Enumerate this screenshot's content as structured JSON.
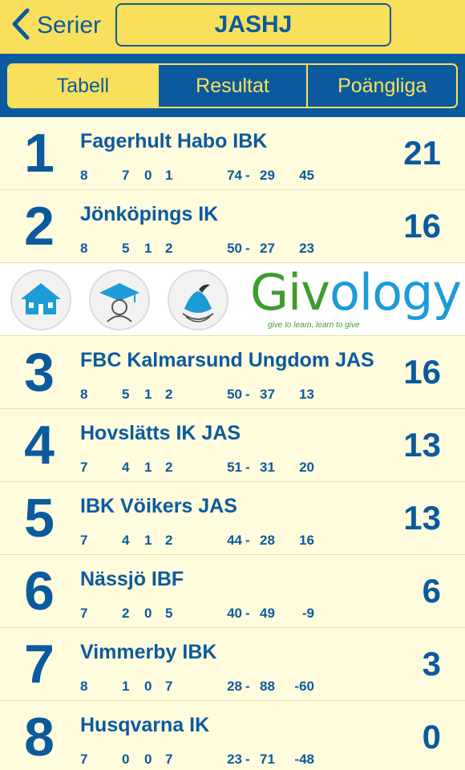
{
  "header": {
    "back_label": "Serier",
    "title": "JASHJ"
  },
  "tabs": [
    {
      "label": "Tabell",
      "active": true
    },
    {
      "label": "Resultat",
      "active": false
    },
    {
      "label": "Poängliga",
      "active": false
    }
  ],
  "standings": [
    {
      "rank": "1",
      "team": "Fagerhult Habo IBK",
      "gp": "8",
      "w": "7",
      "d": "0",
      "l": "1",
      "gf": "74",
      "ga": "29",
      "diff": "45",
      "pts": "21"
    },
    {
      "rank": "2",
      "team": "Jönköpings IK",
      "gp": "8",
      "w": "5",
      "d": "1",
      "l": "2",
      "gf": "50",
      "ga": "27",
      "diff": "23",
      "pts": "16"
    },
    {
      "rank": "3",
      "team": "FBC Kalmarsund Ungdom JAS",
      "gp": "8",
      "w": "5",
      "d": "1",
      "l": "2",
      "gf": "50",
      "ga": "37",
      "diff": "13",
      "pts": "16"
    },
    {
      "rank": "4",
      "team": "Hovslätts IK JAS",
      "gp": "7",
      "w": "4",
      "d": "1",
      "l": "2",
      "gf": "51",
      "ga": "31",
      "diff": "20",
      "pts": "13"
    },
    {
      "rank": "5",
      "team": "IBK Vöikers JAS",
      "gp": "7",
      "w": "4",
      "d": "1",
      "l": "2",
      "gf": "44",
      "ga": "28",
      "diff": "16",
      "pts": "13"
    },
    {
      "rank": "6",
      "team": "Nässjö IBF",
      "gp": "7",
      "w": "2",
      "d": "0",
      "l": "5",
      "gf": "40",
      "ga": "49",
      "diff": "-9",
      "pts": "6"
    },
    {
      "rank": "7",
      "team": "Vimmerby IBK",
      "gp": "8",
      "w": "1",
      "d": "0",
      "l": "7",
      "gf": "28",
      "ga": "88",
      "diff": "-60",
      "pts": "3"
    },
    {
      "rank": "8",
      "team": "Husqvarna IK",
      "gp": "7",
      "w": "0",
      "d": "0",
      "l": "7",
      "gf": "23",
      "ga": "71",
      "diff": "-48",
      "pts": "0"
    }
  ],
  "ad": {
    "brand": "Givology",
    "tagline": "give to learn, learn to give"
  },
  "colors": {
    "primary_blue": "#0b5a9e",
    "accent_yellow": "#f9e05c",
    "row_background": "#fffbdd"
  },
  "icons": {
    "back": "chevron-left-icon",
    "ad_icons": [
      "school-house-icon",
      "graduate-icon",
      "hands-icon"
    ]
  }
}
